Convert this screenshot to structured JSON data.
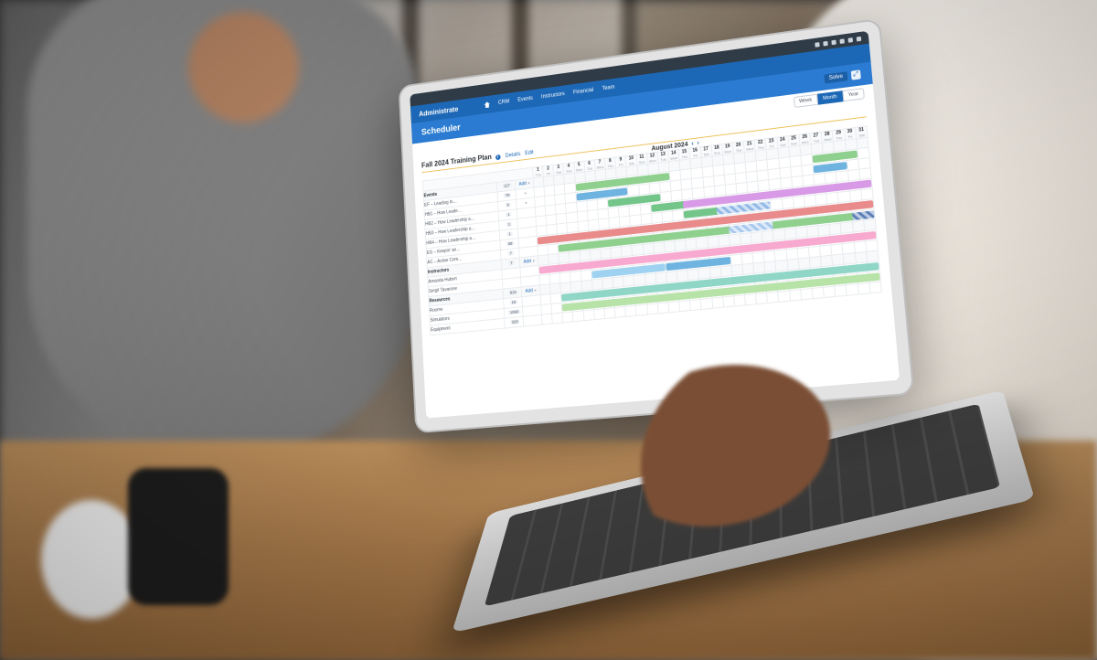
{
  "brand": "Administrate",
  "nav": {
    "home": "Home",
    "items": [
      "CRM",
      "Events",
      "Instructors",
      "Financial",
      "Team"
    ]
  },
  "page_title": "Scheduler",
  "solve_label": "Solve",
  "view": {
    "options": [
      "Week",
      "Month",
      "Year"
    ],
    "selected": "Month"
  },
  "plan": {
    "title": "Fall 2024 Training Plan",
    "details": "Details",
    "edit": "Edit"
  },
  "month": {
    "label": "August 2024"
  },
  "add_label": "Add",
  "days": [
    {
      "n": "1",
      "w": "Thu"
    },
    {
      "n": "2",
      "w": "Fri"
    },
    {
      "n": "3",
      "w": "Sat"
    },
    {
      "n": "4",
      "w": "Sun"
    },
    {
      "n": "5",
      "w": "Mon"
    },
    {
      "n": "6",
      "w": "Tue"
    },
    {
      "n": "7",
      "w": "Wed"
    },
    {
      "n": "8",
      "w": "Thu"
    },
    {
      "n": "9",
      "w": "Fri"
    },
    {
      "n": "10",
      "w": "Sat"
    },
    {
      "n": "11",
      "w": "Sun"
    },
    {
      "n": "12",
      "w": "Mon"
    },
    {
      "n": "13",
      "w": "Tue"
    },
    {
      "n": "14",
      "w": "Wed"
    },
    {
      "n": "15",
      "w": "Thu"
    },
    {
      "n": "16",
      "w": "Fri"
    },
    {
      "n": "17",
      "w": "Sat"
    },
    {
      "n": "18",
      "w": "Sun"
    },
    {
      "n": "19",
      "w": "Mon"
    },
    {
      "n": "20",
      "w": "Tue"
    },
    {
      "n": "21",
      "w": "Wed"
    },
    {
      "n": "22",
      "w": "Thu"
    },
    {
      "n": "23",
      "w": "Fri"
    },
    {
      "n": "24",
      "w": "Sat"
    },
    {
      "n": "25",
      "w": "Sun"
    },
    {
      "n": "26",
      "w": "Mon"
    },
    {
      "n": "27",
      "w": "Tue"
    },
    {
      "n": "28",
      "w": "Wed"
    },
    {
      "n": "29",
      "w": "Thu"
    },
    {
      "n": "30",
      "w": "Fri"
    },
    {
      "n": "31",
      "w": "Sat"
    }
  ],
  "groups": [
    {
      "name": "Events",
      "count": "117",
      "add": true,
      "rows": [
        {
          "label": "EF – Leading In…",
          "count": "78",
          "sub": true,
          "bars": [
            {
              "s": 5,
              "e": 13,
              "c": "#8fd08f"
            },
            {
              "s": 27,
              "e": 30,
              "c": "#8fd08f"
            }
          ]
        },
        {
          "label": "HB1 – How Leade…",
          "count": "9",
          "sub": true,
          "bars": [
            {
              "s": 5,
              "e": 9,
              "c": "#6fb3e0"
            },
            {
              "s": 27,
              "e": 29,
              "c": "#6fb3e0"
            }
          ]
        },
        {
          "label": "HB2 – How Leadership a…",
          "count": "1",
          "bars": [
            {
              "s": 8,
              "e": 12,
              "c": "#74c58a"
            }
          ]
        },
        {
          "label": "HB3 – How Leadership a…",
          "count": "1",
          "bars": [
            {
              "s": 12,
              "e": 15,
              "c": "#74c58a"
            },
            {
              "s": 15,
              "e": 31,
              "c": "#d89ae6"
            }
          ]
        },
        {
          "label": "HB4 – How Leadership a…",
          "count": "1",
          "bars": [
            {
              "s": 15,
              "e": 20,
              "c": "#74c58a"
            },
            {
              "s": 18,
              "e": 22,
              "c": "#8fb7e6",
              "hatch": true
            }
          ]
        },
        {
          "label": "EG – Keepin' an…",
          "count": "68",
          "bars": [
            {
              "s": 1,
              "e": 31,
              "c": "#e98b8b"
            }
          ]
        },
        {
          "label": "AC – Active Com…",
          "count": "7",
          "bars": [
            {
              "s": 3,
              "e": 19,
              "c": "#8fd08f"
            },
            {
              "s": 19,
              "e": 23,
              "c": "#a7c8ee",
              "hatch": true
            },
            {
              "s": 23,
              "e": 31,
              "c": "#8fd08f"
            },
            {
              "s": 30,
              "e": 31,
              "c": "#5c7fb8",
              "hatch": true
            }
          ]
        }
      ]
    },
    {
      "name": "Instructors",
      "count": "7",
      "add": true,
      "rows": [
        {
          "label": "Amanda Hubert",
          "bars": [
            {
              "s": 1,
              "e": 31,
              "c": "#f7a9d0"
            }
          ]
        },
        {
          "label": "Sergil Tavarone",
          "bars": [
            {
              "s": 6,
              "e": 12,
              "c": "#9fd2f0"
            },
            {
              "s": 13,
              "e": 18,
              "c": "#6fb3e0"
            }
          ]
        }
      ]
    },
    {
      "name": "Resources",
      "count": "915",
      "add": true,
      "rows": [
        {
          "label": "Rooms",
          "count": "19",
          "bars": [
            {
              "s": 3,
              "e": 31,
              "c": "#8fd6c7"
            }
          ]
        },
        {
          "label": "Simulators",
          "count": "1069",
          "bars": [
            {
              "s": 3,
              "e": 31,
              "c": "#b7e2a8"
            }
          ]
        },
        {
          "label": "Equipment",
          "count": "329",
          "bars": []
        }
      ]
    }
  ],
  "colors": {
    "brand": "#1d68b6",
    "brand_light": "#2a7bd1"
  }
}
